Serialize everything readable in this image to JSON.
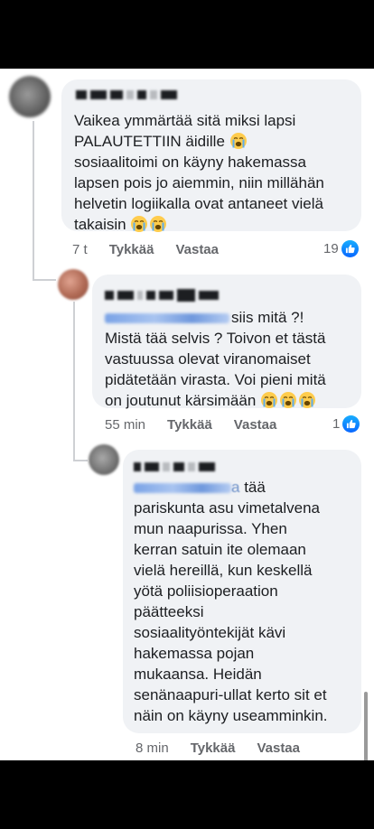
{
  "comments": [
    {
      "text_lines": [
        "Vaikea ymmärtää sitä miksi lapsi",
        "PALAUTETTIIN äidille"
      ],
      "text_lines_b": [
        "sosiaalitoimi on käyny hakemassa",
        "lapsen pois jo aiemmin, niin millähän",
        "helvetin logiikalla ovat antaneet vielä",
        "takaisin"
      ],
      "time": "7 t",
      "like_label": "Tykkää",
      "reply_label": "Vastaa",
      "reaction_count": "19"
    },
    {
      "text_first_suffix": "siis mitä ?!",
      "text_lines": [
        "Mistä tää selvis ? Toivon et tästä",
        "vastuussa olevat viranomaiset",
        "pidätetään virasta. Voi pieni mitä",
        "on joutunut kärsimään"
      ],
      "time": "55 min",
      "like_label": "Tykkää",
      "reply_label": "Vastaa",
      "reaction_count": "1"
    },
    {
      "mention_tail": "a",
      "text_first_suffix": " tää",
      "text_lines": [
        "pariskunta asu vimetalvena",
        "mun naapurissa. Yhen",
        "kerran satuin ite olemaan",
        "vielä hereillä, kun keskellä",
        "yötä poliisioperaation",
        "päätteeksi",
        "sosiaalityöntekijät kävi",
        "hakemassa pojan",
        "mukaansa. Heidän",
        "senänaapuri-ullat kerto sit et",
        "näin on käyny useamminkin."
      ],
      "time": "8 min",
      "like_label": "Tykkää",
      "reply_label": "Vastaa"
    }
  ],
  "icons": {
    "crying": "loudly-crying-face-icon",
    "like": "thumbs-up-icon"
  },
  "colors": {
    "bubble": "#f0f2f5",
    "like_blue": "#0866ff",
    "meta_gray": "#65676b"
  }
}
